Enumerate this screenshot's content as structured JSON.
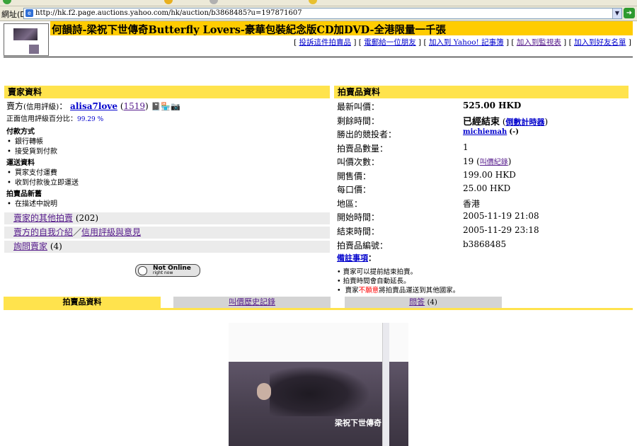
{
  "browser": {
    "address_label": "網址(D)",
    "url": "http://hk.f2.page.auctions.yahoo.com/hk/auction/b3868485?u=197871607"
  },
  "header": {
    "title": "何韻詩-梁祝下世傳奇Butterfly Lovers-豪華包裝紀念版CD加DVD-全港限量一千張",
    "actions": [
      "投訴這件拍賣品",
      "電郵給一位朋友",
      "加入到 Yahoo! 記事簿",
      "加入到監視表",
      "加入到好友名單"
    ]
  },
  "seller": {
    "section_title": "賣家資料",
    "label": "賣方",
    "label_note": "(信用評級)",
    "name": "alisa7love",
    "rating": "1519",
    "positive_label": "正面信用評級百分比：",
    "positive_value": "99.29 %",
    "payment_title": "付款方式",
    "payment_items": [
      "銀行轉帳",
      "接受貨到付款"
    ],
    "shipping_title": "運送資料",
    "shipping_items": [
      "買家支付運費",
      "收到付款後立即運送"
    ],
    "condition_title": "拍賣品新舊",
    "condition_items": [
      "在描述中說明"
    ],
    "other_auctions": "賣家的其他拍賣",
    "other_count": "(202)",
    "intro_link": "賣方的自我介紹",
    "sep": "／",
    "rating_link": "信用評級與意見",
    "ask_link": "詢問賣家",
    "ask_count": "(4)",
    "online_main": "Not Online",
    "online_sub": "right now"
  },
  "auction": {
    "section_title": "拍賣品資料",
    "current_label": "最新叫價：",
    "current_value": "525.00 HKD",
    "remaining_label": "剩餘時間：",
    "remaining_value": "已經結束",
    "countdown_link": "倒數計時器",
    "winner_label": "勝出的競投者：",
    "winner_name": "michiemah",
    "winner_score": "(-)",
    "qty_label": "拍賣品數量：",
    "qty_value": "1",
    "bids_label": "叫價次數：",
    "bids_value": "19",
    "bid_history_link": "叫價紀錄",
    "start_price_label": "開售價：",
    "start_price_value": "199.00 HKD",
    "increment_label": "每口價：",
    "increment_value": "25.00 HKD",
    "region_label": "地區：",
    "region_value": "香港",
    "start_time_label": "開始時間：",
    "start_time_value": "2005-11-19 21:08",
    "end_time_label": "結束時間：",
    "end_time_value": "2005-11-29 23:18",
    "id_label": "拍賣品編號：",
    "id_value": "b3868485",
    "notes_link": "備註事項",
    "notes_colon": "：",
    "note1": "賣家可以提前結束拍賣。",
    "note2": "拍賣時間會自動延長。",
    "note3_pre": "賣家",
    "note3_red": "不願意",
    "note3_post": "將拍賣品運送到其他國家。"
  },
  "tabs": {
    "item_info": "拍賣品資料",
    "bid_history": "叫價歷史記錄",
    "qa": "問答",
    "qa_count": "(4)"
  },
  "photo": {
    "caption": "梁祝下世傳奇"
  },
  "colors": {
    "title_bar": "#ffcc00",
    "section_bar": "#ffe34d",
    "link": "#0000cc",
    "visited": "#551a8b",
    "warning": "#ff0000"
  }
}
